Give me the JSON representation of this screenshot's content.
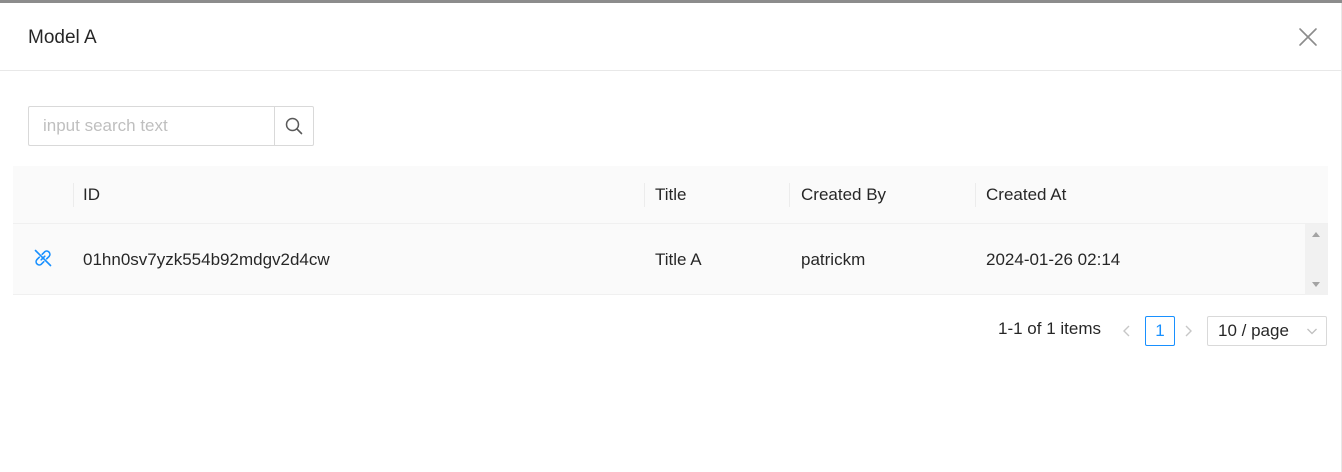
{
  "modal": {
    "title": "Model A"
  },
  "search": {
    "placeholder": "input search text"
  },
  "table": {
    "columns": [
      "ID",
      "Title",
      "Created By",
      "Created At"
    ],
    "rows": [
      {
        "id": "01hn0sv7yzk554b92mdgv2d4cw",
        "title": "Title A",
        "created_by": "patrickm",
        "created_at": "2024-01-26 02:14"
      }
    ]
  },
  "pagination": {
    "total_text": "1-1 of 1 items",
    "prev_label": "<",
    "current_page": "1",
    "next_label": ">",
    "page_size": "10 / page"
  },
  "colors": {
    "primary": "#1890ff",
    "header_bg": "#fafafa",
    "border": "#d9d9d9"
  },
  "icons": {
    "close": "close-icon",
    "search": "search-icon",
    "unlink": "unlink-icon",
    "chevron": "chevron-down-icon"
  }
}
